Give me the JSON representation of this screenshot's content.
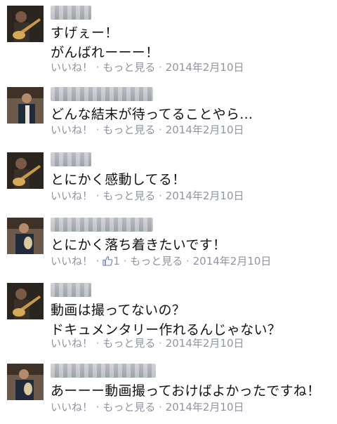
{
  "comments": [
    {
      "lines": [
        "すげぇー！",
        "がんばれーーー！"
      ],
      "like_label": "いいね！",
      "more_label": "もっと見る",
      "date": "2014年2月10日",
      "separator": "·"
    },
    {
      "lines": [
        "どんな結末が待ってることやら..."
      ],
      "like_label": "いいね！",
      "more_label": "もっと見る",
      "date": "2014年2月10日",
      "separator": "·"
    },
    {
      "lines": [
        "とにかく感動してる！"
      ],
      "like_label": "いいね！",
      "more_label": "もっと見る",
      "date": "2014年2月10日",
      "separator": "·"
    },
    {
      "lines": [
        "とにかく落ち着きたいです！"
      ],
      "like_label": "いいね！",
      "like_count": "1",
      "more_label": "もっと見る",
      "date": "2014年2月10日",
      "separator": "·"
    },
    {
      "lines": [
        "動画は撮ってないの？",
        "ドキュメンタリー作れるんじゃない？"
      ],
      "like_label": "いいね！",
      "more_label": "もっと見る",
      "date": "2014年2月10日",
      "separator": "·"
    },
    {
      "lines": [
        "あーーー動画撮っておけばよかったですね！"
      ],
      "like_label": "いいね！",
      "more_label": "もっと見る",
      "date": "2014年2月10日",
      "separator": "·"
    }
  ],
  "colors": {
    "meta_text": "#8f94a0",
    "like_accent": "#6d84b4",
    "comment_text": "#111111"
  },
  "icons": {
    "like_count_icon": "thumbs-up-icon"
  }
}
